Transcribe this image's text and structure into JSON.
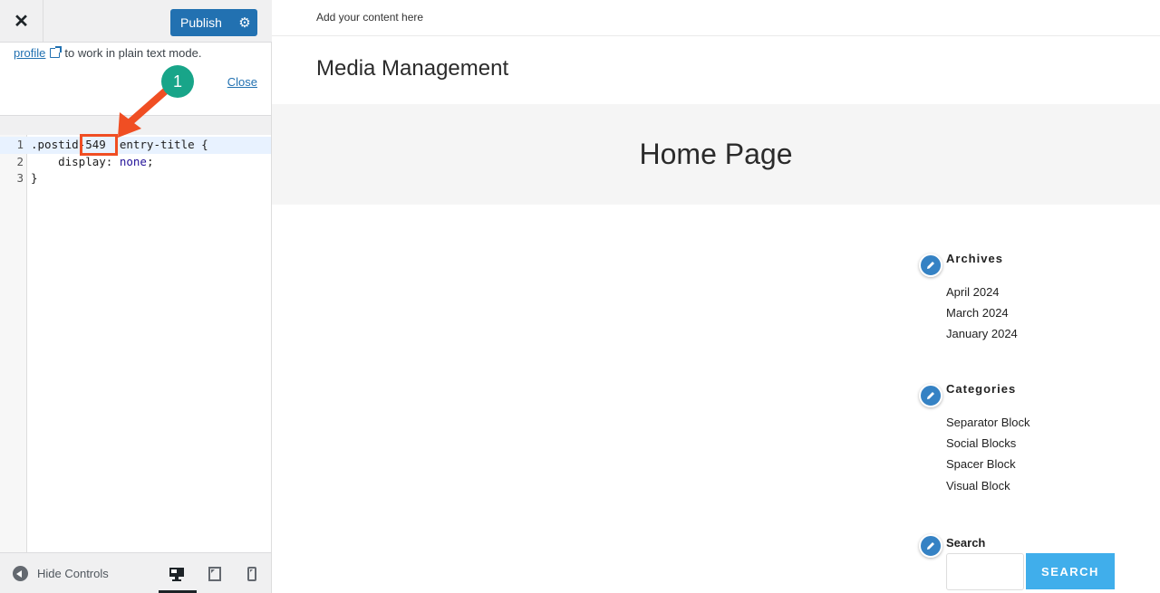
{
  "panel": {
    "close_label": "✕",
    "publish_label": "Publish",
    "notice": {
      "link_text": "profile",
      "text": "to work in plain text mode.",
      "close_link": "Close"
    },
    "code_lines": [
      {
        "num": "1",
        "selector": ".postid-549 .entry-title {"
      },
      {
        "num": "2",
        "prop": "    display: ",
        "value": "none",
        "end": ";"
      },
      {
        "num": "3",
        "text": "}"
      }
    ],
    "annotation_badge": "1",
    "footer": {
      "hide_controls": "Hide Controls",
      "devices": [
        "desktop",
        "tablet",
        "mobile"
      ],
      "active_device": "desktop"
    }
  },
  "preview": {
    "topbar_text": "Add your content here",
    "site_title": "Media Management",
    "page_title": "Home Page",
    "widgets": {
      "archives": {
        "title": "Archives",
        "items": [
          "April 2024",
          "March 2024",
          "January 2024"
        ]
      },
      "categories": {
        "title": "Categories",
        "items": [
          "Separator Block",
          "Social Blocks",
          "Spacer Block",
          "Visual Block"
        ]
      },
      "search": {
        "title": "Search",
        "input_value": "",
        "button_label": "SEARCH"
      }
    }
  },
  "colors": {
    "accent": "#2271b1",
    "annotation_red": "#f04e23",
    "annotation_green": "#18a589",
    "search_button": "#40aeeb"
  }
}
